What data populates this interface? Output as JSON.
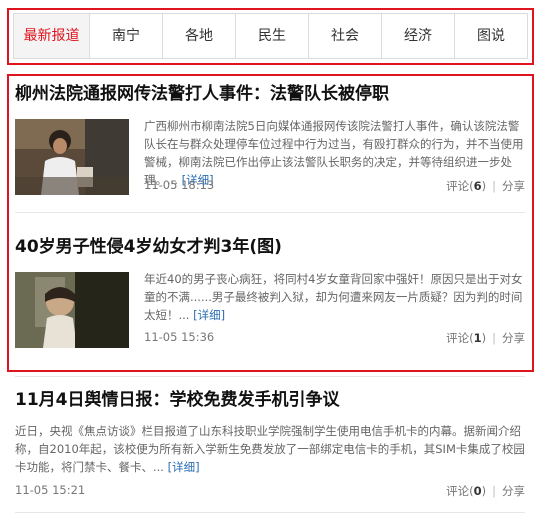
{
  "tabs": [
    {
      "label": "最新报道",
      "active": true
    },
    {
      "label": "南宁"
    },
    {
      "label": "各地"
    },
    {
      "label": "民生"
    },
    {
      "label": "社会"
    },
    {
      "label": "经济"
    },
    {
      "label": "图说"
    }
  ],
  "articles": [
    {
      "title": "柳州法院通报网传法警打人事件：法警队长被停职",
      "summary": "广西柳州市柳南法院5日向媒体通报网传该院法警打人事件，确认该院法警队长在与群众处理停车位过程中行为过当，有殴打群众的行为，并不当使用警械，柳南法院已作出停止该法警队长职务的决定，并等待组织进一步处理。...",
      "detail_label": "[详细]",
      "time": "11-05 18:13",
      "comment_label": "评论",
      "comment_count": "6",
      "share_label": "分享"
    },
    {
      "title": "40岁男子性侵4岁幼女才判3年(图)",
      "summary": "年近40的男子丧心病狂，将同村4岁女童背回家中强奸！原因只是出于对女童的不满......男子最终被判入狱，却为何遭来网友一片质疑？因为判的时间太短！...",
      "detail_label": "[详细]",
      "time": "11-05 15:36",
      "comment_label": "评论",
      "comment_count": "1",
      "share_label": "分享"
    },
    {
      "title": "11月4日舆情日报：学校免费发手机引争议",
      "summary": "近日，央视《焦点访谈》栏目报道了山东科技职业学院强制学生使用电信手机卡的内幕。据新闻介绍称，自2010年起，该校便为所有新入学新生免费发放了一部绑定电信卡的手机，其SIM卡集成了校园卡功能，将门禁卡、餐卡、...",
      "detail_label": "[详细]",
      "time": "11-05 15:21",
      "comment_label": "评论",
      "comment_count": "0",
      "share_label": "分享"
    }
  ],
  "colors": {
    "accent": "#e0141e",
    "link": "#2a6eb3"
  }
}
